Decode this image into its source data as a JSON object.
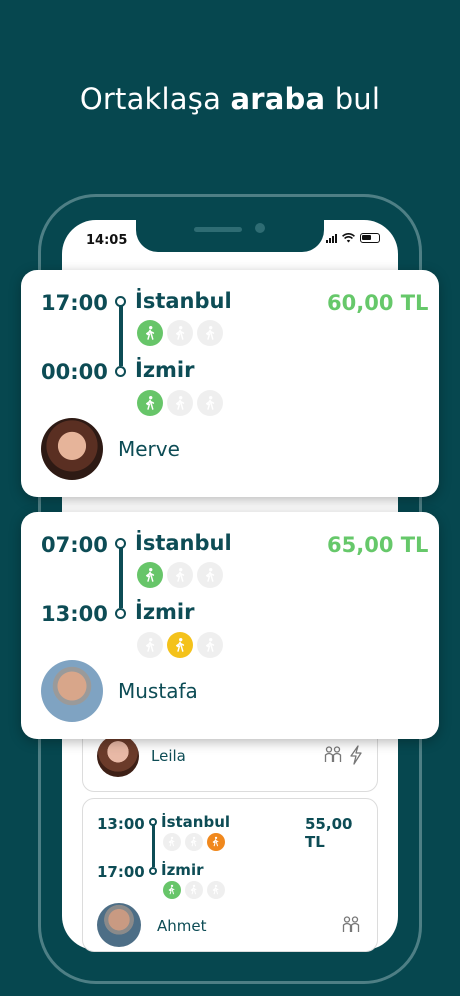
{
  "headline": {
    "regular": "Ortaklaşa",
    "bold": "araba",
    "suffix": "bul"
  },
  "status_bar": {
    "time": "14:05"
  },
  "colors": {
    "background": "#06474f",
    "primary": "#0d4c55",
    "price": "#66c86a",
    "seat_taken": "#67c569",
    "seat_free": "#efefef",
    "seat_highlight": "#f4c21b",
    "seat_orange": "#f0881d"
  },
  "cards": [
    {
      "depart_time": "17:00",
      "from": "İstanbul",
      "arrive_time": "00:00",
      "to": "İzmir",
      "price": "60,00 TL",
      "driver": "Merve",
      "from_seats": [
        "green",
        "gray",
        "gray"
      ],
      "to_seats": [
        "green",
        "gray",
        "gray"
      ]
    },
    {
      "depart_time": "07:00",
      "from": "İstanbul",
      "arrive_time": "13:00",
      "to": "İzmir",
      "price": "65,00 TL",
      "driver": "Mustafa",
      "from_seats": [
        "green",
        "gray",
        "gray"
      ],
      "to_seats": [
        "gray",
        "yellow",
        "gray"
      ]
    }
  ],
  "list": [
    {
      "driver": "Leila",
      "features": [
        "two-people-icon",
        "lightning-icon"
      ]
    },
    {
      "depart_time": "13:00",
      "from": "İstanbul",
      "arrive_time": "17:00",
      "to": "İzmir",
      "price": "55,00 TL",
      "driver": "Ahmet",
      "from_seats": [
        "gray",
        "gray",
        "orange"
      ],
      "to_seats": [
        "green",
        "gray",
        "gray"
      ],
      "features": [
        "two-people-icon"
      ]
    }
  ]
}
